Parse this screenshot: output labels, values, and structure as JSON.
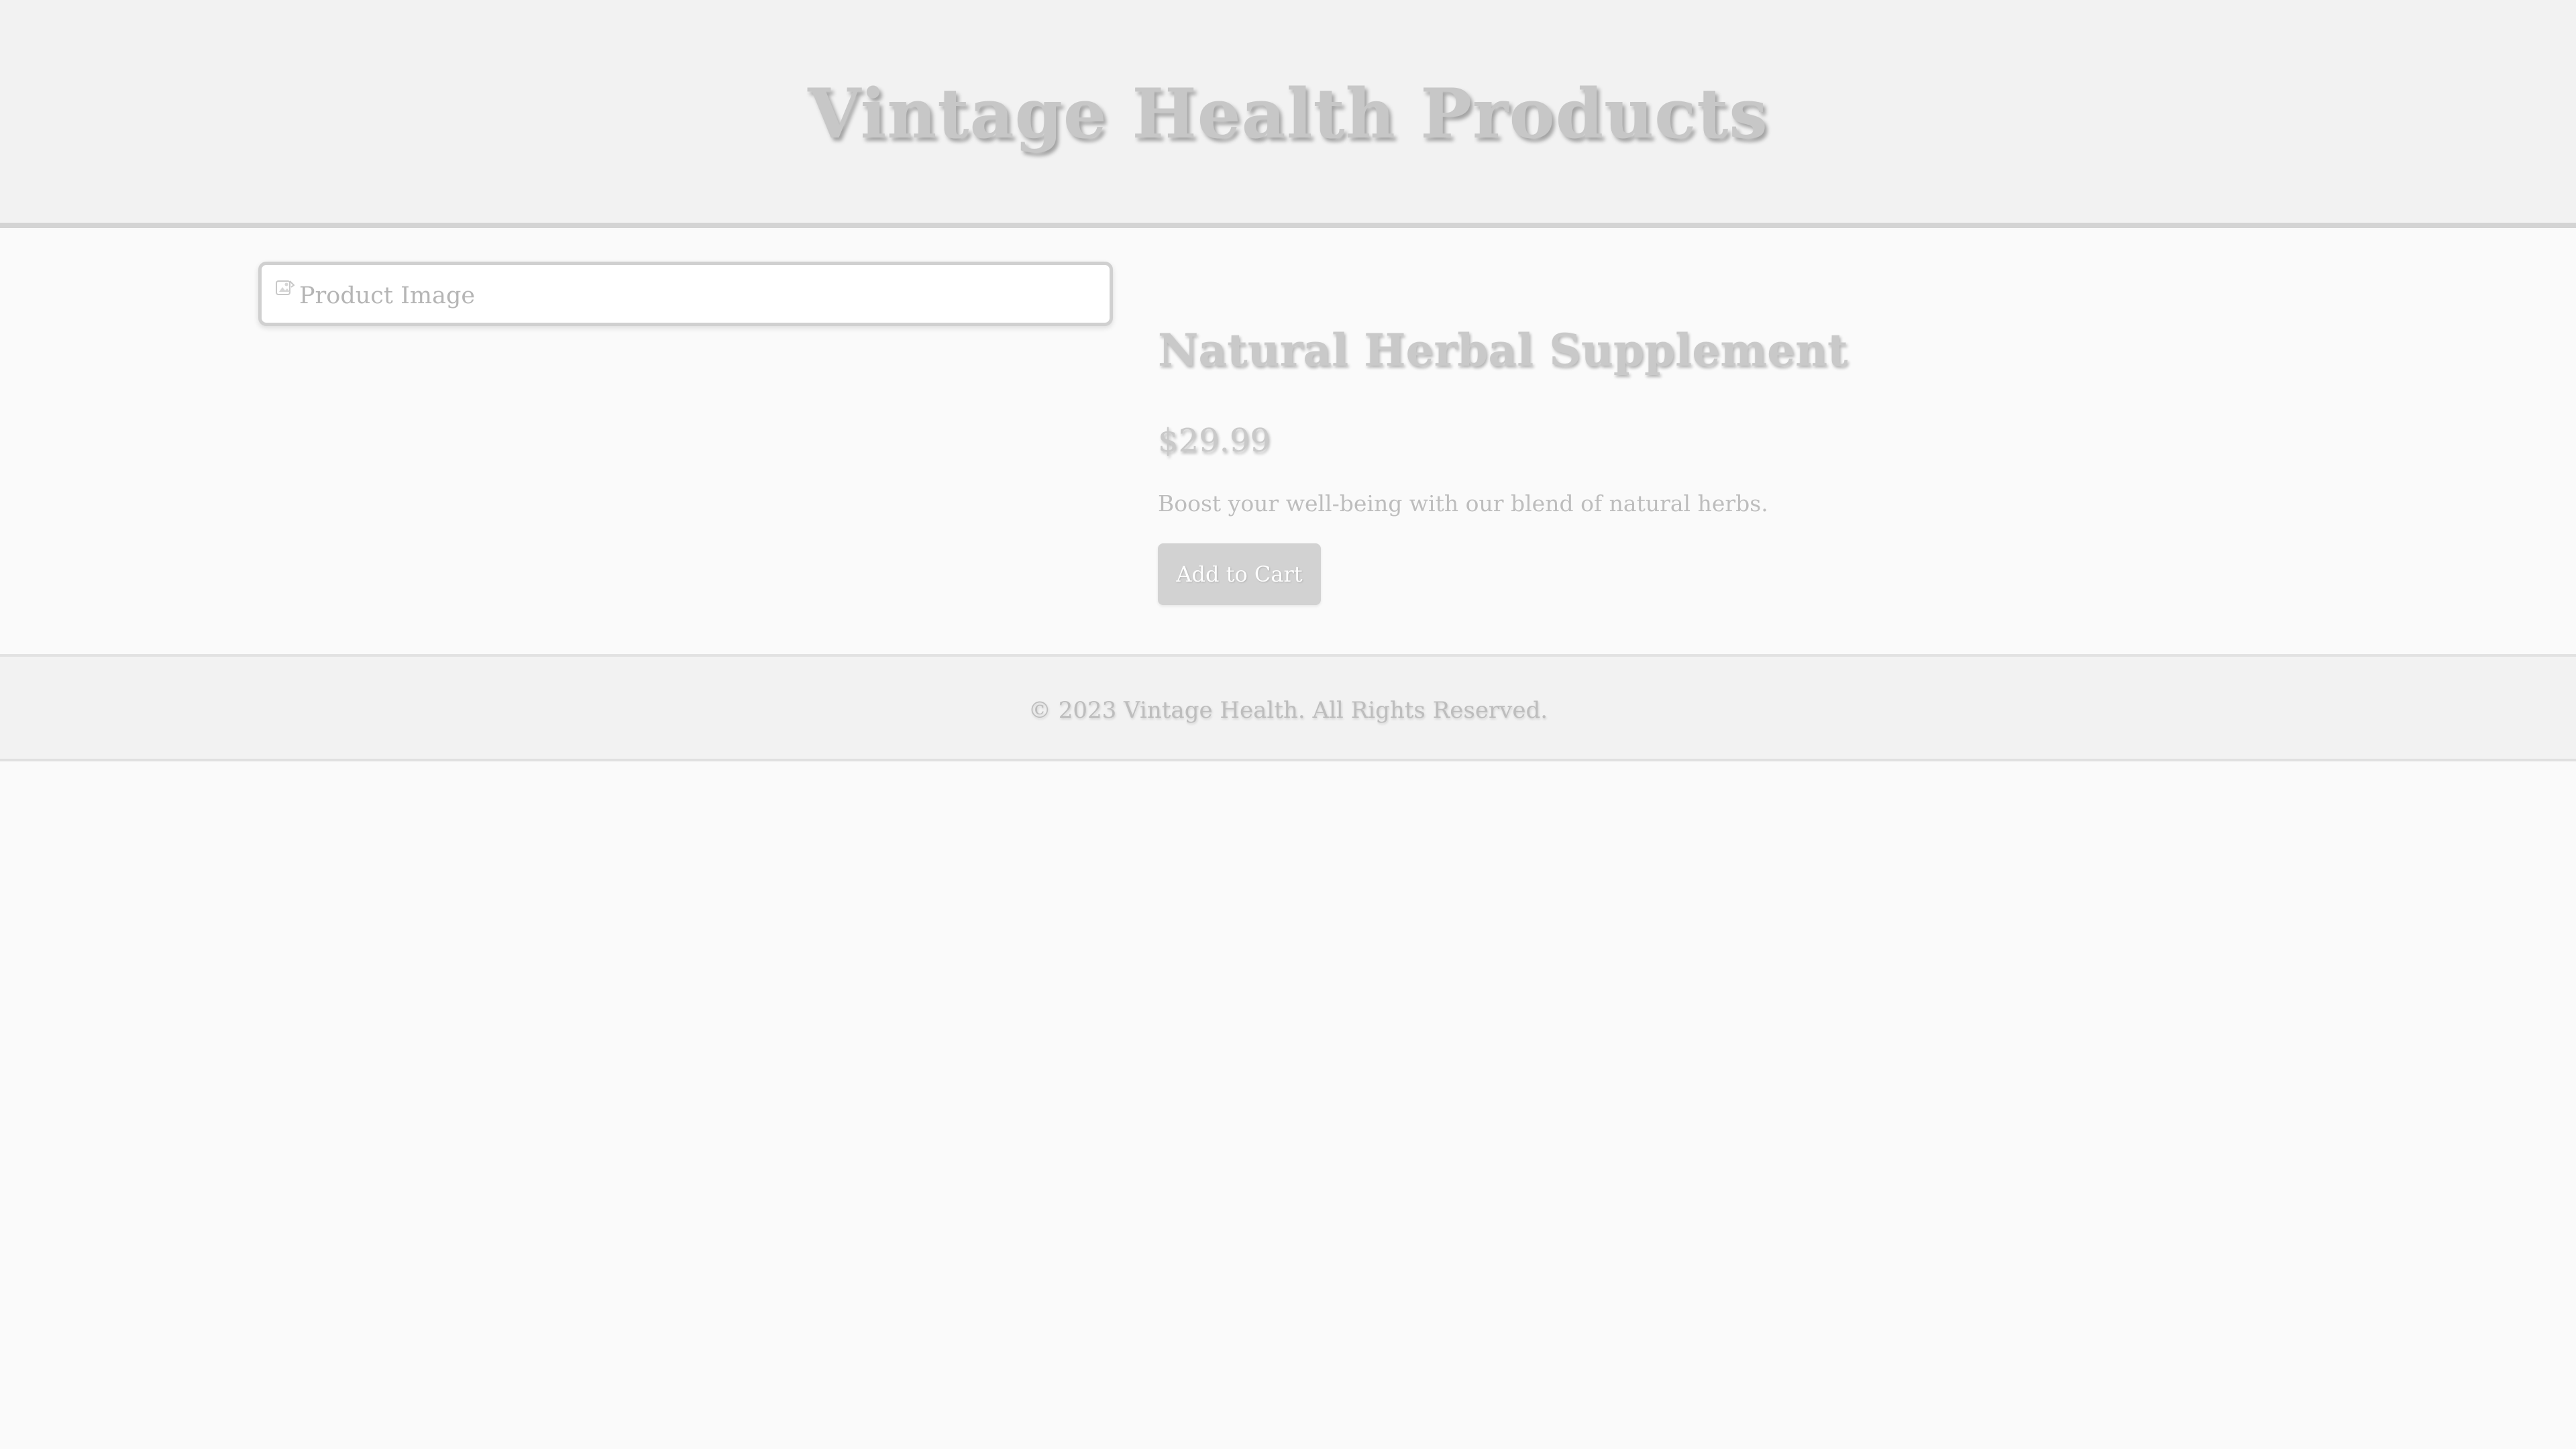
{
  "header": {
    "title": "Vintage Health Products"
  },
  "product": {
    "image_alt": "Product Image",
    "name": "Natural Herbal Supplement",
    "price": "$29.99",
    "description": "Boost your well-being with our blend of natural herbs.",
    "add_to_cart_label": "Add to Cart"
  },
  "footer": {
    "copyright": "© 2023 Vintage Health. All Rights Reserved."
  },
  "colors": {
    "background": "#fafafa",
    "header_background": "#f2f2f2",
    "title_text": "#c7c7c7",
    "button_background": "#d2d2d2"
  },
  "icons": {
    "image_placeholder": "broken-image-icon"
  }
}
